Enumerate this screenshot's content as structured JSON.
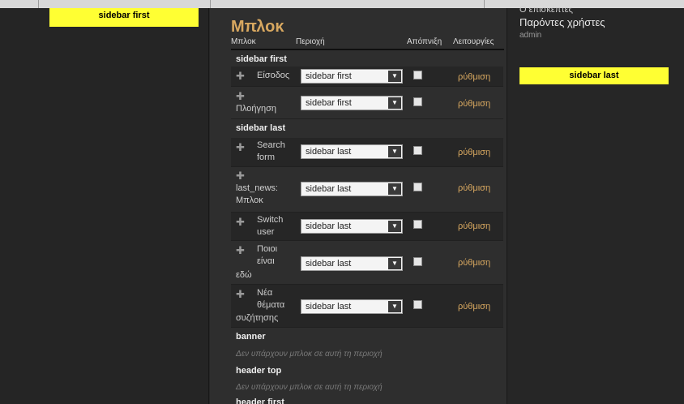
{
  "left": {
    "block_title": "sidebar first"
  },
  "right": {
    "cut_text": "Ο επισκέπτες",
    "title": "Παρόντες χρήστες",
    "user": "admin",
    "block_title": "sidebar last"
  },
  "main": {
    "title": "Μπλοκ",
    "headers": {
      "block": "Μπλοκ",
      "region": "Περιοχή",
      "disable": "Απόπνιξη",
      "operations": "Λειτουργίες"
    },
    "configure_label": "ρύθμιση",
    "empty_text": "Δεν υπάρχουν μπλοκ σε αυτή τη περιοχή",
    "regions": [
      "sidebar first",
      "sidebar last",
      "banner",
      "header top",
      "header first"
    ],
    "rows": [
      {
        "name": [
          "Είσοδος"
        ],
        "region": "sidebar first"
      },
      {
        "name": [
          "Πλοήγηση"
        ],
        "region": "sidebar first"
      },
      {
        "name": [
          "Search",
          "form"
        ],
        "region": "sidebar last"
      },
      {
        "name": [
          "last_news:",
          "Μπλοκ"
        ],
        "region": "sidebar last"
      },
      {
        "name": [
          "Switch",
          "user"
        ],
        "region": "sidebar last"
      },
      {
        "name": [
          "Ποιοι",
          "είναι",
          "εδώ"
        ],
        "region": "sidebar last"
      },
      {
        "name": [
          "Νέα",
          "θέματα",
          "συζήτησης"
        ],
        "region": "sidebar last"
      }
    ]
  }
}
